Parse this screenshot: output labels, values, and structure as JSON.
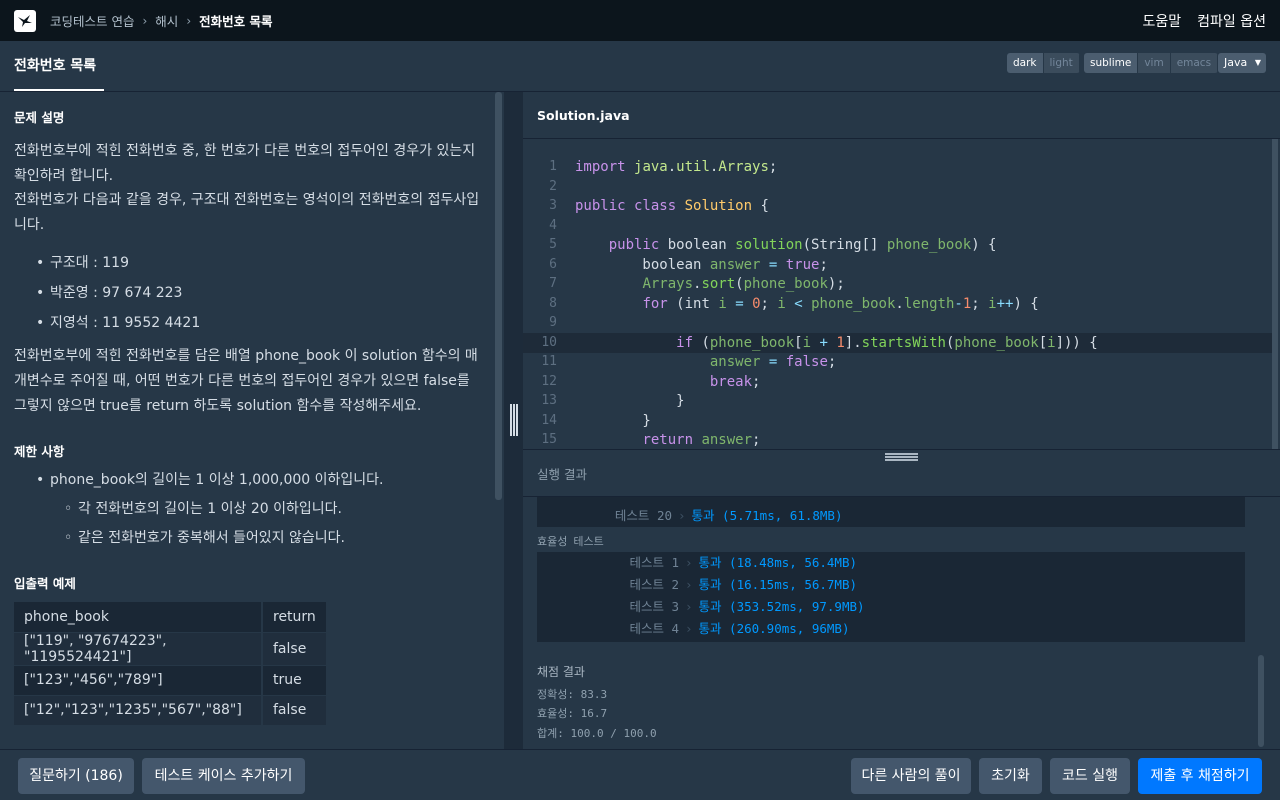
{
  "topnav": {
    "breadcrumb": [
      "코딩테스트 연습",
      "해시",
      "전화번호 목록"
    ],
    "sep": "›",
    "links": [
      "도움말",
      "컴파일 옵션"
    ]
  },
  "tabbar": {
    "title": "전화번호 목록",
    "theme": [
      "dark",
      "light"
    ],
    "keymap": [
      "sublime",
      "vim",
      "emacs"
    ],
    "language": "Java"
  },
  "problem": {
    "heading": "문제 설명",
    "para1_line1": "전화번호부에 적힌 전화번호 중, 한 번호가 다른 번호의 접두어인 경우가 있는지",
    "para1_line2": "확인하려 합니다.",
    "para1_line3": "전화번호가 다음과 같을 경우, 구조대 전화번호는 영석이의 전화번호의 접두사입",
    "para1_line4": "니다.",
    "examples": [
      "구조대 : 119",
      "박준영 : 97 674 223",
      "지영석 : 11 9552 4421"
    ],
    "para2_line1": "전화번호부에 적힌 전화번호를 담은 배열 phone_book 이 solution 함수의 매",
    "para2_line2": "개변수로 주어질 때, 어떤 번호가 다른 번호의 접두어인 경우가 있으면 false를",
    "para2_line3": "그렇지 않으면 true를 return 하도록 solution 함수를 작성해주세요.",
    "limits_heading": "제한 사항",
    "limit1": "phone_book의 길이는 1 이상 1,000,000 이하입니다.",
    "sublimits": [
      "각 전화번호의 길이는 1 이상 20 이하입니다.",
      "같은 전화번호가 중복해서 들어있지 않습니다."
    ],
    "io_heading": "입출력 예제",
    "io_table": {
      "headers": [
        "phone_book",
        "return"
      ],
      "rows": [
        [
          "[\"119\", \"97674223\", \"1195524421\"]",
          "false"
        ],
        [
          "[\"123\",\"456\",\"789\"]",
          "true"
        ],
        [
          "[\"12\",\"123\",\"1235\",\"567\",\"88\"]",
          "false"
        ]
      ]
    }
  },
  "editor": {
    "filename": "Solution.java",
    "line_numbers": [
      "1",
      "2",
      "3",
      "4",
      "5",
      "6",
      "7",
      "8",
      "9",
      "10",
      "11",
      "12",
      "13",
      "14",
      "15"
    ]
  },
  "results": {
    "heading": "실행 결과",
    "accuracy_last": {
      "name": "테스트 20",
      "result": "통과 (5.71ms, 61.8MB)"
    },
    "efficiency_label": "효율성",
    "efficiency_sub": "테스트",
    "efficiency": [
      {
        "name": "테스트 1",
        "result": "통과 (18.48ms, 56.4MB)"
      },
      {
        "name": "테스트 2",
        "result": "통과 (16.15ms, 56.7MB)"
      },
      {
        "name": "테스트 3",
        "result": "통과 (353.52ms, 97.9MB)"
      },
      {
        "name": "테스트 4",
        "result": "통과 (260.90ms, 96MB)"
      }
    ],
    "grade_heading": "채점 결과",
    "grade_accuracy": "정확성: 83.3",
    "grade_efficiency": "효율성: 16.7",
    "grade_total": "합계: 100.0 / 100.0"
  },
  "bottom": {
    "ask": "질문하기 (186)",
    "add_testcase": "테스트 케이스 추가하기",
    "others": "다른 사람의 풀이",
    "reset": "초기화",
    "run": "코드 실행",
    "submit": "제출 후 채점하기"
  }
}
